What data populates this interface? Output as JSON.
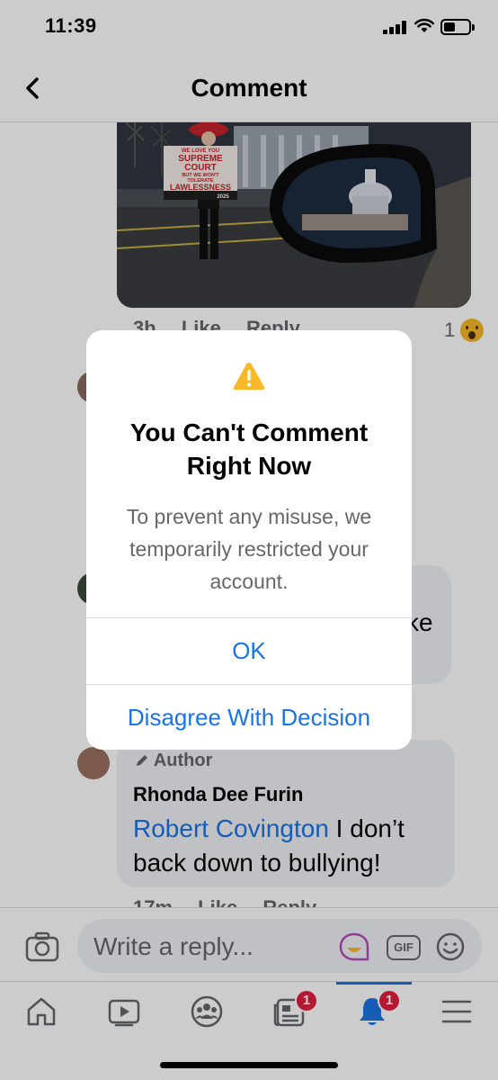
{
  "status_bar": {
    "time": "11:39"
  },
  "header": {
    "title": "Comment"
  },
  "photo_comment": {
    "time": "3h",
    "like": "Like",
    "reply": "Reply",
    "reaction_count": "1"
  },
  "last_comment": {
    "badge": "Author",
    "name": "Rhonda Dee Furin",
    "mention": "Robert Covington",
    "text": " I don’t back down to bullying!",
    "time": "17m",
    "like": "Like",
    "reply": "Reply"
  },
  "partial_text": "ke",
  "composer": {
    "placeholder": "Write a reply...",
    "gif_label": "GIF"
  },
  "tab_bar": {
    "feed_badge": "1",
    "notifications_badge": "1"
  },
  "dialog": {
    "title": "You Can't Comment Right Now",
    "message": "To prevent any misuse, we temporarily restricted your account.",
    "ok_label": "OK",
    "disagree_label": "Disagree With Decision"
  },
  "photo_sign": {
    "line1": "WE LOVE YOU",
    "line2": "SUPREME",
    "line3": "COURT",
    "line4": "BUT WE WON'T",
    "line5": "TOLERATE",
    "line6": "LAWLESSNESS",
    "year": "2025"
  },
  "colors": {
    "accent": "#1b74e4",
    "badge": "#e41e3f",
    "warning": "#f7b928"
  }
}
